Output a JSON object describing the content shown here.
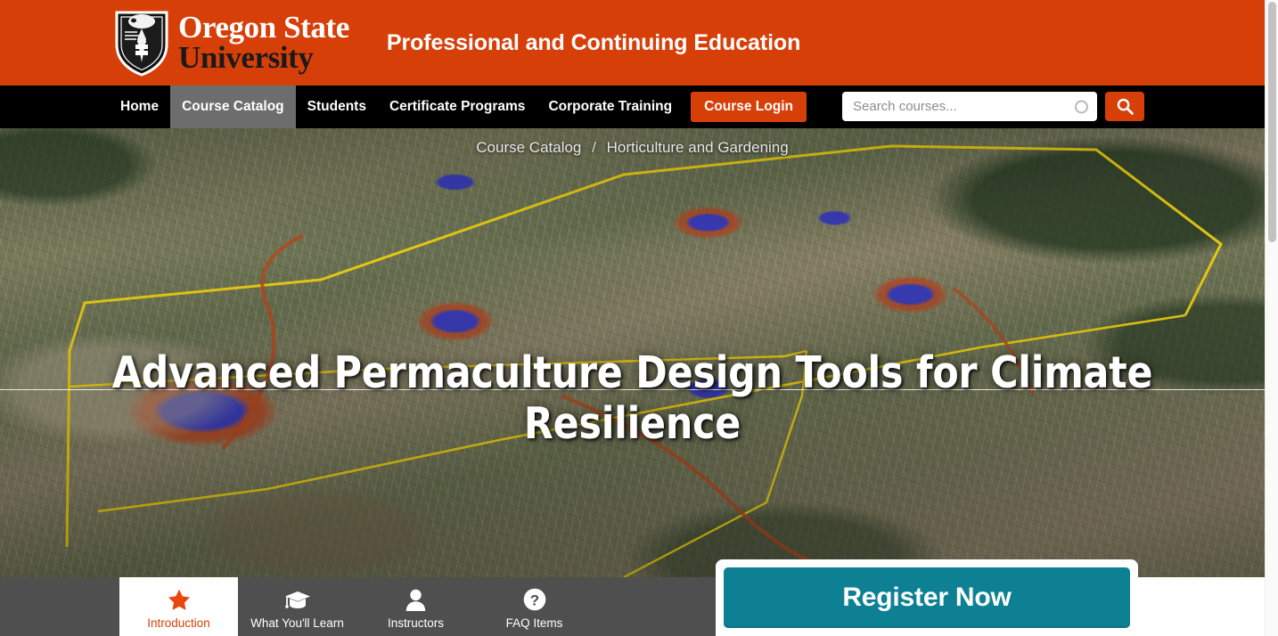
{
  "header": {
    "logo_line1": "Oregon State",
    "logo_line2": "University",
    "logo_icon": "osu-beaver-shield-icon",
    "tagline": "Professional and Continuing Education",
    "brand_orange": "#d73f09"
  },
  "nav": {
    "items": [
      {
        "label": "Home",
        "active": false
      },
      {
        "label": "Course Catalog",
        "active": true
      },
      {
        "label": "Students",
        "active": false
      },
      {
        "label": "Certificate Programs",
        "active": false
      },
      {
        "label": "Corporate Training",
        "active": false
      }
    ],
    "cta_label": "Course Login",
    "active_bg": "#6d6d6d"
  },
  "search": {
    "placeholder": "Search courses...",
    "value": "",
    "spinner_icon": "circle-spinner-icon",
    "button_icon": "search-icon",
    "button_color": "#d73f09"
  },
  "hero": {
    "breadcrumb": {
      "parent": "Course Catalog",
      "separator": "/",
      "current": "Horticulture and Gardening"
    },
    "title": "Advanced Permaculture Design Tools for Climate Resilience",
    "background_description": "aerial topographic site map with contour lines, yellow property boundary, orange swales and blue water ponds"
  },
  "tabs": [
    {
      "label": "Introduction",
      "icon": "star-icon",
      "active": true
    },
    {
      "label": "What You'll Learn",
      "icon": "graduation-cap-icon",
      "active": false
    },
    {
      "label": "Instructors",
      "icon": "person-icon",
      "active": false
    },
    {
      "label": "FAQ Items",
      "icon": "question-circle-icon",
      "active": false
    }
  ],
  "register": {
    "label": "Register Now",
    "color": "#0e8094"
  },
  "scrollbar": {
    "thumb_color": "#c2c2c2"
  }
}
